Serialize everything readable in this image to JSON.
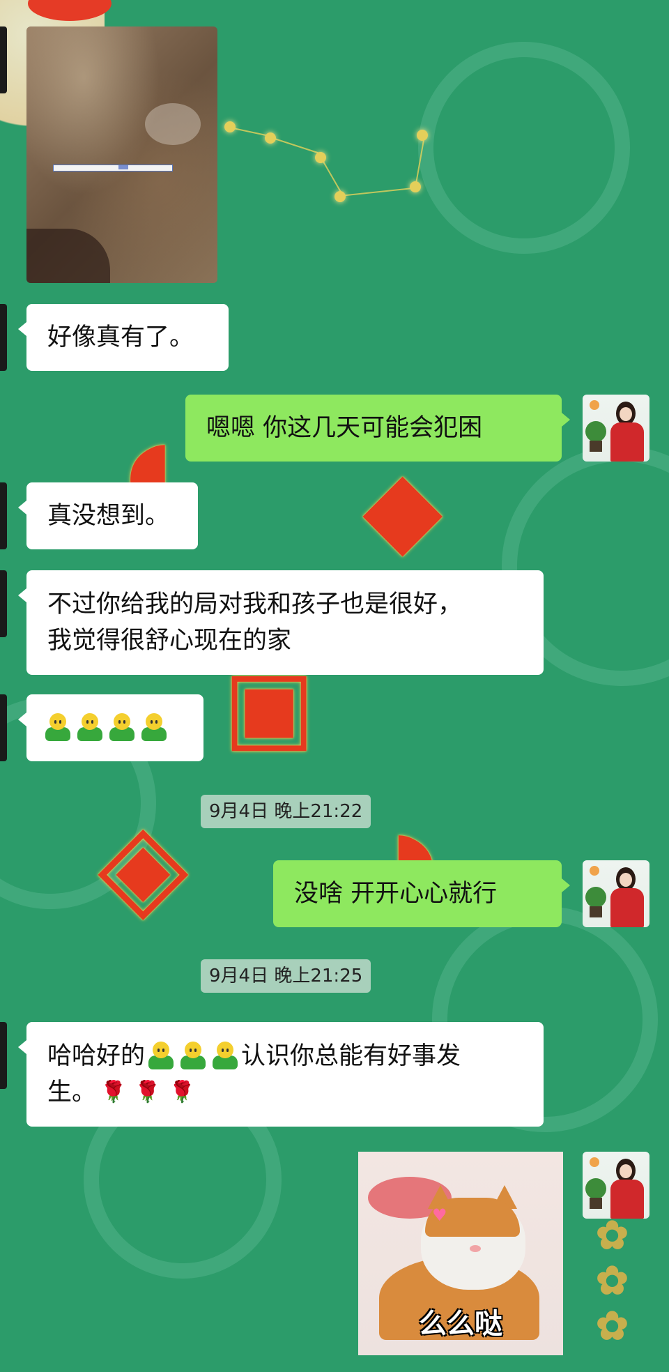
{
  "messages": {
    "m1": "好像真有了。",
    "m2": "嗯嗯  你这几天可能会犯困",
    "m3": "真没想到。",
    "m4_line1": "不过你给我的局对我和孩子也是很好，",
    "m4_line2": "我觉得很舒心现在的家",
    "m5_prefix": "哈哈好的",
    "m5_mid": "认识你总能有好事发",
    "m5_line2": "生。",
    "m6": "没啥  开开心心就行"
  },
  "timestamps": {
    "t1": "9月4日  晚上21:22",
    "t2": "9月4日  晚上21:25"
  },
  "sticker": {
    "caption": "么么哒"
  },
  "icons": {
    "emoji": "smiling-person-emoji",
    "rose": "rose-emoji",
    "avatar": "woman-in-red-dress-avatar"
  },
  "colors": {
    "background": "#2c9c6a",
    "incoming_bubble": "#ffffff",
    "outgoing_bubble": "#8ee85f"
  }
}
